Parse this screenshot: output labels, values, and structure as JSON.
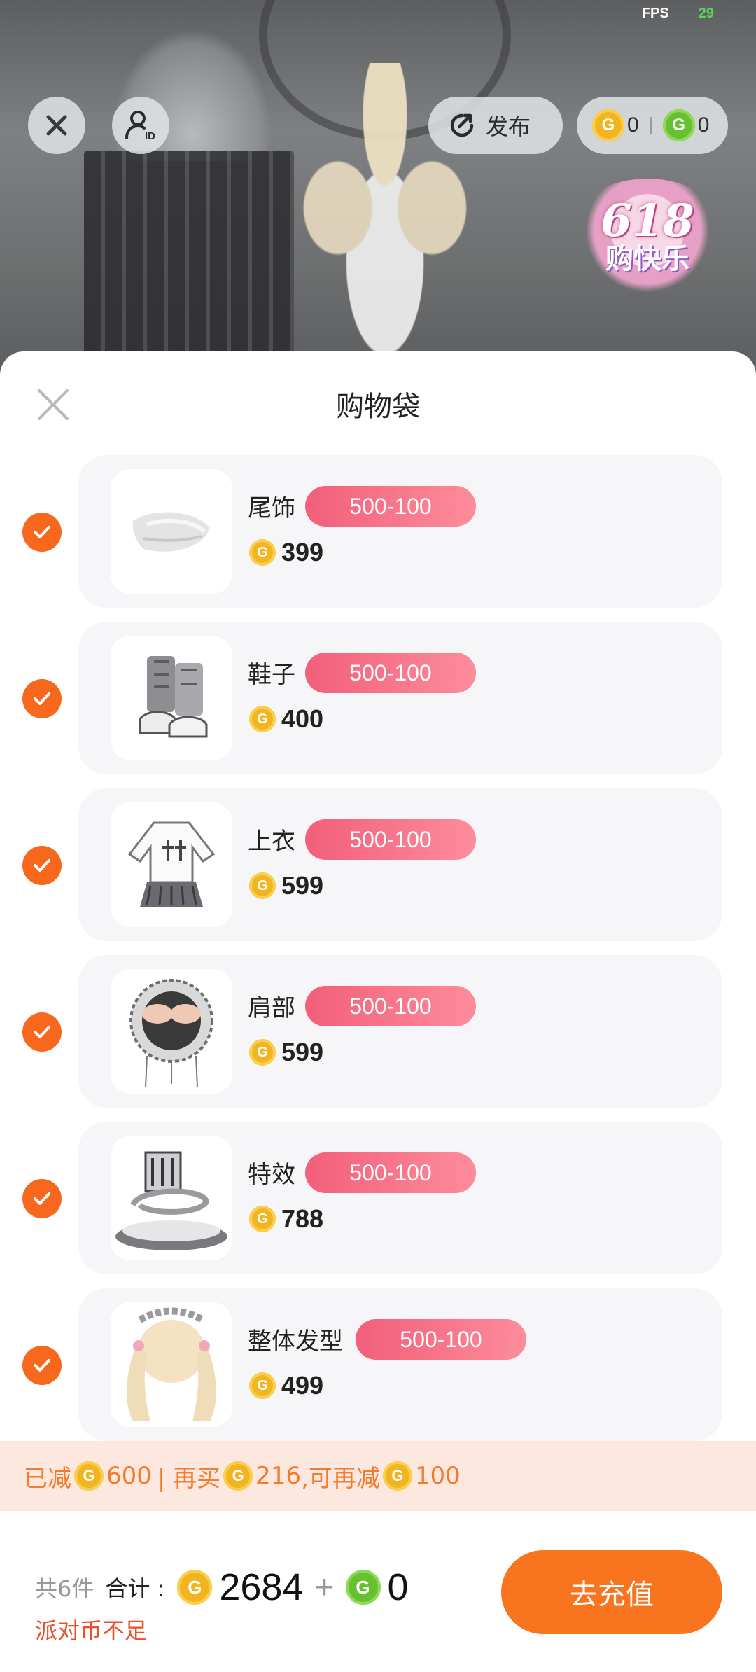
{
  "status": {
    "fps_label": "FPS",
    "fps_value": "29"
  },
  "topbar": {
    "publish_label": "发布",
    "gold_balance": "0",
    "green_balance": "0"
  },
  "promo_logo": {
    "line1": "618",
    "line2": "购快乐"
  },
  "sheet": {
    "title": "购物袋"
  },
  "items": [
    {
      "name": "尾饰",
      "discount": "500-100",
      "price": "399",
      "checked": true
    },
    {
      "name": "鞋子",
      "discount": "500-100",
      "price": "400",
      "checked": true
    },
    {
      "name": "上衣",
      "discount": "500-100",
      "price": "599",
      "checked": true
    },
    {
      "name": "肩部",
      "discount": "500-100",
      "price": "599",
      "checked": true
    },
    {
      "name": "特效",
      "discount": "500-100",
      "price": "788",
      "checked": true
    },
    {
      "name": "整体发型",
      "discount": "500-100",
      "price": "499",
      "checked": true
    }
  ],
  "promo_strip": {
    "reduced_label": "已减",
    "reduced_amount": "600",
    "buy_more_label": "| 再买",
    "buy_more_amount": "216",
    "reduce_more_label": ",可再减",
    "reduce_more_amount": "100"
  },
  "footer": {
    "count_label": "共6件",
    "sum_label": "合计 :",
    "gold_total": "2684",
    "plus": "+",
    "green_total": "0",
    "warning": "派对币不足",
    "recharge_label": "去充值"
  },
  "colors": {
    "accent_orange": "#f7681c",
    "discount_pink": "#f25f7a",
    "gold_coin": "#f2b521",
    "green_coin": "#66c12f",
    "warning_red": "#e9512d"
  },
  "icons": [
    "close-icon",
    "user-id-icon",
    "publish-icon",
    "gold-coin-icon",
    "green-coin-icon",
    "check-icon"
  ]
}
